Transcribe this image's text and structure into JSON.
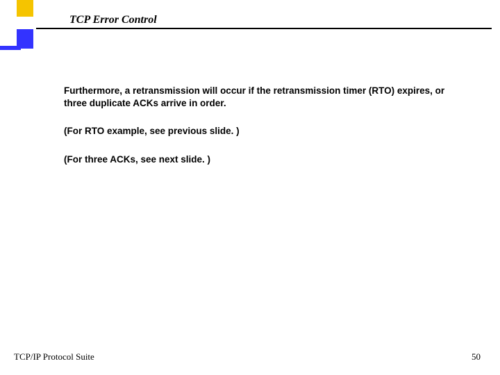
{
  "header": {
    "title": "TCP Error Control"
  },
  "body": {
    "para1": "Furthermore, a retransmission will occur if the retransmission timer (RTO) expires, or three duplicate ACKs arrive in order.",
    "para2": "(For RTO example, see previous slide. )",
    "para3": "(For three ACKs, see next slide. )"
  },
  "footer": {
    "left": "TCP/IP Protocol Suite",
    "page_number": "50"
  }
}
